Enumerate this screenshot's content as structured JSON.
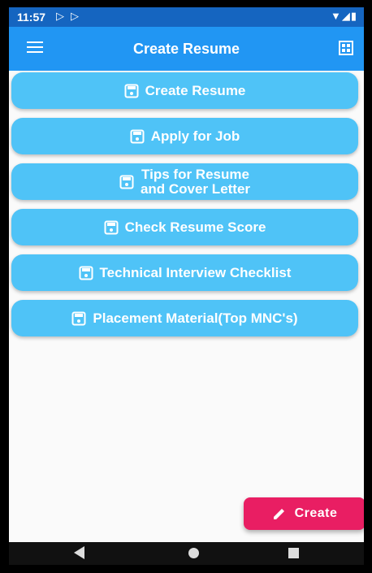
{
  "status_bar": {
    "time": "11:57",
    "notification_icons": [
      "play-store-icon",
      "play-store-icon"
    ],
    "right_icons": [
      "wifi-icon",
      "signal-icon",
      "battery-icon"
    ]
  },
  "app_bar": {
    "title": "Create Resume",
    "menu_icon": "hamburger-menu-icon",
    "action_icon": "grid-icon",
    "color": "#2196f3"
  },
  "buttons": [
    {
      "label": "Create Resume"
    },
    {
      "label": "Apply for Job"
    },
    {
      "label_line1": "Tips for Resume",
      "label_line2": "and Cover Letter"
    },
    {
      "label": "Check Resume Score"
    },
    {
      "label": "Technical Interview Checklist"
    },
    {
      "label": "Placement Material(Top MNC's)"
    }
  ],
  "button_color": "#4fc3f7",
  "button_icon": "save-icon",
  "fab": {
    "label": "Create",
    "icon": "pencil-icon",
    "color": "#e91e63"
  },
  "nav_bar": {
    "back": "back-icon",
    "home": "home-icon",
    "recents": "recents-icon"
  }
}
